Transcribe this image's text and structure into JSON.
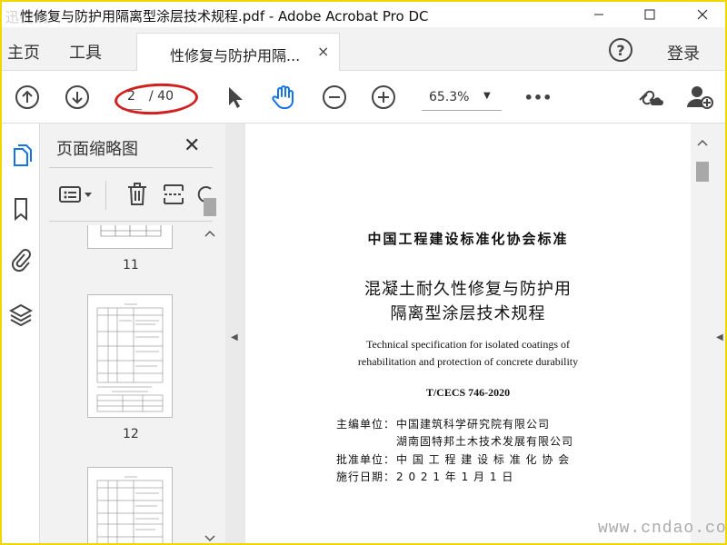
{
  "window": {
    "title": "性修复与防护用隔离型涂层技术规程.pdf - Adobe Acrobat Pro DC",
    "watermark_top": "迅捷网"
  },
  "menu": {
    "home": "主页",
    "tools": "工具",
    "doc_tab_label": "性修复与防护用隔...",
    "doc_tab_close": "×",
    "help": "?",
    "login": "登录"
  },
  "toolbar": {
    "page_current": "2",
    "page_total": "/ 40",
    "zoom": "65.3%",
    "more": "•••"
  },
  "panel": {
    "title": "页面缩略图",
    "close": "✕",
    "thumbs": [
      {
        "page": "11"
      },
      {
        "page": "12"
      }
    ]
  },
  "document": {
    "org_title": "中国工程建设标准化协会标准",
    "title_line1": "混凝土耐久性修复与防护用",
    "title_line2": "隔离型涂层技术规程",
    "en_line1": "Technical specification for isolated coatings of",
    "en_line2": "rehabilitation and protection of concrete durability",
    "standard_no": "T/CECS 746-2020",
    "chief_label": "主编单位：",
    "chief_unit1": "中国建筑科学研究院有限公司",
    "chief_unit2": "湖南固特邦土木技术发展有限公司",
    "approve_label": "批准单位：",
    "approve_unit": "中 国 工 程 建 设 标 准 化 协 会",
    "date_label": "施行日期：",
    "date_value": "2  0  2  1  年   1  月   1  日"
  },
  "watermark_bottom": "www.cndao.com",
  "colors": {
    "accent_blue": "#1473e6",
    "highlight_red": "#d02020",
    "frame_yellow": "#f2d600"
  }
}
